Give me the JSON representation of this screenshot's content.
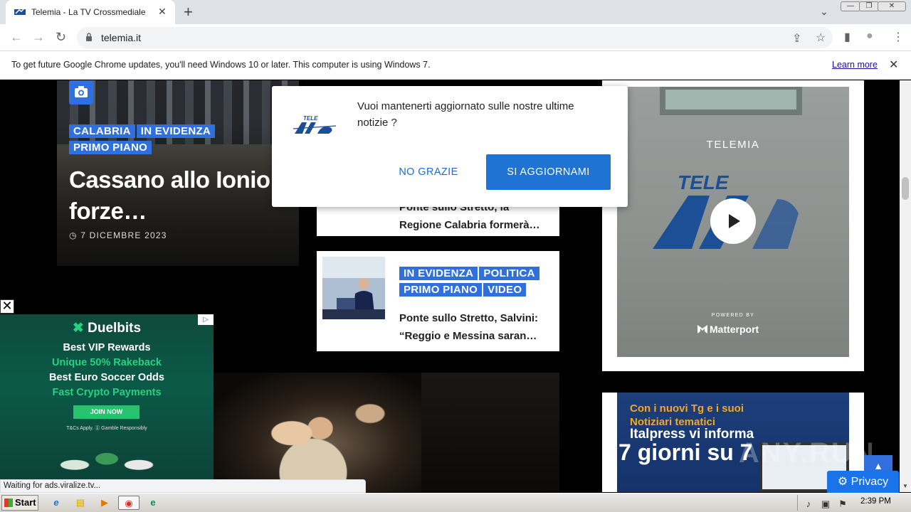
{
  "browser": {
    "tab_title": "Telemia - La TV Crossmediale",
    "tab_close": "✕",
    "new_tab": "+",
    "url": "telemia.it",
    "back": "←",
    "forward": "→",
    "reload": "↻",
    "tab_search": "⌄",
    "win_min": "—",
    "win_max": "❐",
    "win_close": "✕",
    "share_icon": "⇪",
    "star_icon": "☆",
    "sidepanel_icon": "▮",
    "profile_icon": "●",
    "menu_icon": "⋮"
  },
  "infobar": {
    "text": "To get future Google Chrome updates, you'll need Windows 10 or later. This computer is using Windows 7.",
    "learn_more": "Learn more",
    "close": "✕"
  },
  "hero": {
    "tags": [
      "CALABRIA",
      "IN EVIDENZA",
      "PRIMO PIANO"
    ],
    "title": "Cassano allo Ionio: forze…",
    "date": "7 DICEMBRE 2023",
    "clock_icon": "◷"
  },
  "card1": {
    "title": "Ponte sullo Stretto, la Regione Calabria formerà…"
  },
  "card2": {
    "tags": [
      "IN EVIDENZA",
      "POLITICA",
      "PRIMO PIANO",
      "VIDEO"
    ],
    "title": "Ponte sullo Stretto, Salvini: “Reggio e Messina saran…"
  },
  "matterport": {
    "label": "TELEMIA",
    "logo_text": "TELE",
    "powered": "POWERED BY",
    "brand": "Matterport"
  },
  "italpress": {
    "line1": "Con i nuovi Tg e i suoi",
    "line2": "Notiziari tematici",
    "line3": "Italpress vi informa",
    "line4": "7 giorni su 7"
  },
  "ad": {
    "close": "✕",
    "badge": "▷",
    "brand": "Duelbits",
    "lines": [
      "Best VIP Rewards",
      "Unique 50% Rakeback",
      "Best Euro Soccer Odds",
      "Fast Crypto Payments"
    ],
    "join": "JOIN NOW",
    "tc": "T&Cs Apply.  ⓖ Gamble Responsibly"
  },
  "popup": {
    "text": "Vuoi mantenerti aggiornato sulle nostre ultime notizie ?",
    "no": "NO GRAZIE",
    "yes": "SI AGGIORNAMI",
    "logo_text": "TELE"
  },
  "status": {
    "text": "Waiting for ads.viralize.tv..."
  },
  "privacy": {
    "label": "⚙ Privacy"
  },
  "totop": {
    "label": "▲"
  },
  "watermark": {
    "text": "ANY.RUN"
  },
  "taskbar": {
    "start": "Start",
    "clock": "2:39 PM",
    "ie_icon": "e",
    "folder_icon": "▤",
    "media_icon": "▶",
    "chrome_icon": "◉",
    "edge_icon": "e",
    "tray_sound": "♪",
    "tray_network": "▣",
    "tray_flag": "⚑"
  },
  "colors": {
    "accent_blue": "#2f6fde",
    "popup_button": "#1e73d3",
    "ad_green": "#27c26e"
  }
}
